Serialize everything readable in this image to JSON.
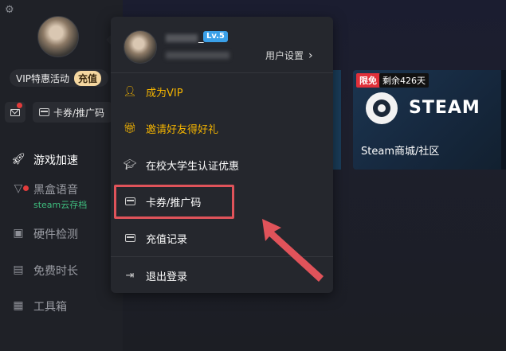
{
  "sidebar": {
    "vip_label": "VIP特惠活动",
    "recharge_label": "充值",
    "coupon_label": "卡券/推广码",
    "nav": [
      {
        "label": "游戏加速",
        "icon": "rocket-icon"
      },
      {
        "label": "黑盒语音",
        "sub": "steam云存档",
        "icon": "voice-icon"
      },
      {
        "label": "硬件检测",
        "icon": "monitor-icon"
      },
      {
        "label": "免费时长",
        "icon": "gift-icon"
      },
      {
        "label": "工具箱",
        "icon": "toolbox-icon"
      }
    ]
  },
  "popup": {
    "username": "_",
    "level": "Lv.5",
    "settings_label": "用户设置",
    "items": [
      {
        "label": "成为VIP",
        "icon": "vip-user-icon"
      },
      {
        "label": "邀请好友得好礼",
        "icon": "gift-icon"
      },
      {
        "label": "在校大学生认证优惠",
        "icon": "graduation-cap-icon"
      },
      {
        "label": "卡券/推广码",
        "icon": "card-icon"
      },
      {
        "label": "充值记录",
        "icon": "card-icon"
      },
      {
        "label": "退出登录",
        "icon": "logout-icon"
      }
    ]
  },
  "game_card": {
    "free_badge": "限免",
    "remaining": "剩余426天",
    "logo_text": "STEAM",
    "title": "Steam商城/社区"
  },
  "colors": {
    "accent_gold": "#f4b400",
    "highlight_red": "#e0535a",
    "level_blue": "#3aa0e8",
    "voice_green": "#3fbf7f"
  }
}
